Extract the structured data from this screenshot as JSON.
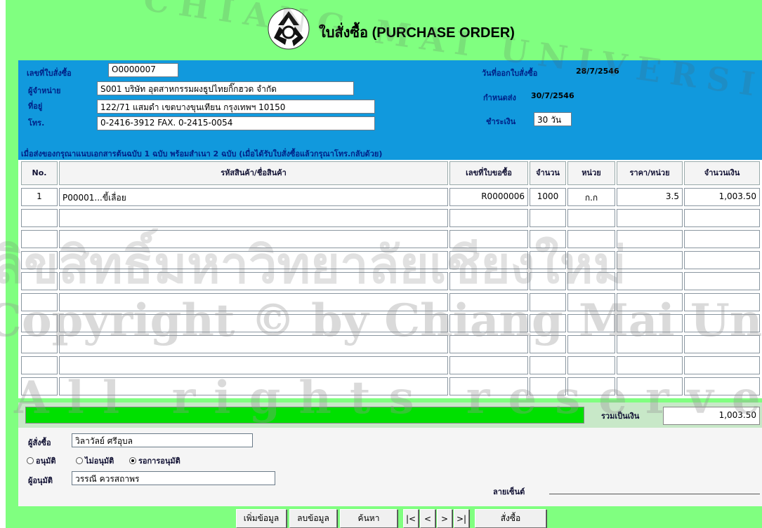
{
  "title": "ใบสั่งซื้อ (PURCHASE ORDER)",
  "logo_icon": "recycle-circle-icon",
  "header": {
    "po_number_label": "เลขที่ใบสั่งซื้อ",
    "po_number": "O0000007",
    "supplier_label": "ผู้จำหน่าย",
    "supplier": "S001  บริษัท อุตสาหกรรมผงธูปไทยกิ๊กฮวด จำกัด",
    "address_label": "ที่อยู่",
    "address": "122/71 แสมดำ เขตบางขุนเทียน กรุงเทพฯ 10150",
    "phone_label": "โทร.",
    "phone": "0-2416-3912 FAX. 0-2415-0054",
    "issue_date_label": "วันที่ออกใบสั่งซื้อ",
    "issue_date": "28/7/2546",
    "delivery_label": "กำหนดส่ง",
    "delivery_date": "30/7/2546",
    "payment_label": "ชำระเงิน",
    "payment_terms": "30 วัน",
    "note": "เมื่อส่งของกรุณาแนบเอกสารต้นฉบับ 1 ฉบับ พร้อมสำเนา 2 ฉบับ (เมื่อได้รับใบสั่งซื้อแล้วกรุณาโทร.กลับด้วย)"
  },
  "table": {
    "columns": [
      "No.",
      "รหัสสินค้า/ชื่อสินค้า",
      "เลขที่ใบขอซื้อ",
      "จำนวน",
      "หน่วย",
      "ราคา/หน่วย",
      "จำนวนเงิน"
    ],
    "rows": [
      [
        "1",
        "P00001...ขี้เลื่อย",
        "R0000006",
        "1000",
        "ก.ก",
        "3.5",
        "1,003.50"
      ],
      [
        "",
        "",
        "",
        "",
        "",
        "",
        ""
      ],
      [
        "",
        "",
        "",
        "",
        "",
        "",
        ""
      ],
      [
        "",
        "",
        "",
        "",
        "",
        "",
        ""
      ],
      [
        "",
        "",
        "",
        "",
        "",
        "",
        ""
      ],
      [
        "",
        "",
        "",
        "",
        "",
        "",
        ""
      ],
      [
        "",
        "",
        "",
        "",
        "",
        "",
        ""
      ],
      [
        "",
        "",
        "",
        "",
        "",
        "",
        ""
      ],
      [
        "",
        "",
        "",
        "",
        "",
        "",
        ""
      ],
      [
        "",
        "",
        "",
        "",
        "",
        "",
        ""
      ]
    ]
  },
  "total": {
    "progress": 1.0,
    "progress_color": "#00e000",
    "label": "รวมเป็นเงิน",
    "value": "1,003.50"
  },
  "footer": {
    "orderer_label": "ผู้สั่งซื้อ",
    "orderer": "วิลาวัลย์ ศรีอุบล",
    "radio_approve": "อนุมัติ",
    "radio_reject": "ไม่อนุมัติ",
    "radio_pending": "รอการอนุมัติ",
    "selected": "pending",
    "approver_label": "ผู้อนุมัติ",
    "approver": "วรรณี ควรสถาพร",
    "signature_label": "ลายเซ็นต์"
  },
  "buttons": {
    "add": "เพิ่มข้อมูล",
    "delete": "ลบข้อมูล",
    "search": "ค้นหา",
    "first": "|<",
    "prev": "<",
    "next": ">",
    "last": ">|",
    "order": "สั่งซื้อ"
  },
  "watermark": {
    "line1": "ลิขสิทธิ์มหาวิทยาลัยเชียงใหม่",
    "line2": "Copyright © by Chiang Mai University",
    "line3": "All rights reserved",
    "arc": "CHIANG MAI UNIVERSITY"
  },
  "colors": {
    "window_bg": "#80ff80",
    "header_bg": "#1199dd",
    "label_color": "#002288"
  }
}
